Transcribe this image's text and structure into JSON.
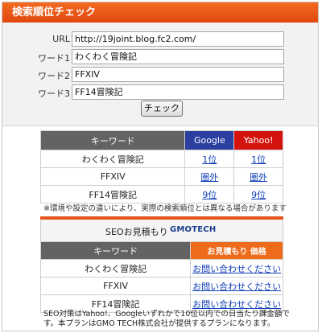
{
  "title": "検索順位チェック",
  "form": {
    "url_label": "URL",
    "url_value": "http://19joint.blog.fc2.com/",
    "kw1_label": "ワード1",
    "kw1_value": "わくわく冒険記",
    "kw2_label": "ワード2",
    "kw2_value": "FFXIV",
    "kw3_label": "ワード3",
    "kw3_value": "FF14冒険記",
    "check_button": "チェック"
  },
  "ranking": {
    "headers": {
      "keyword": "キーワード",
      "google": "Google",
      "yahoo": "Yahoo!"
    },
    "rows": [
      {
        "keyword": "わくわく冒険記",
        "google": "1位",
        "yahoo": "1位"
      },
      {
        "keyword": "FFXIV",
        "google": "圏外",
        "yahoo": "圏外"
      },
      {
        "keyword": "FF14冒険記",
        "google": "9位",
        "yahoo": "9位"
      }
    ],
    "note": "※環境や設定の違いにより、実際の検索順位とは異なる場合があります"
  },
  "seo": {
    "title": "SEOお見積もり",
    "brand": "GMOTECH",
    "headers": {
      "keyword": "キーワード",
      "price": "お見積もり 価格"
    },
    "rows": [
      {
        "keyword": "わくわく冒険記",
        "price": "お問い合わせください"
      },
      {
        "keyword": "FFXIV",
        "price": "お問い合わせください"
      },
      {
        "keyword": "FF14冒険記",
        "price": "お問い合わせください"
      }
    ],
    "footer_line1": "SEO対策はYahoo!、Googleいずれかで10位以内での日当たり課金額で",
    "footer_line2": "す。本プランはGMO TECH株式会社が提供するプランになります。"
  },
  "colors": {
    "accent": "#e5561a",
    "google": "#2a3f9f",
    "yahoo": "#d4130e",
    "link": "#0b3bb6"
  }
}
